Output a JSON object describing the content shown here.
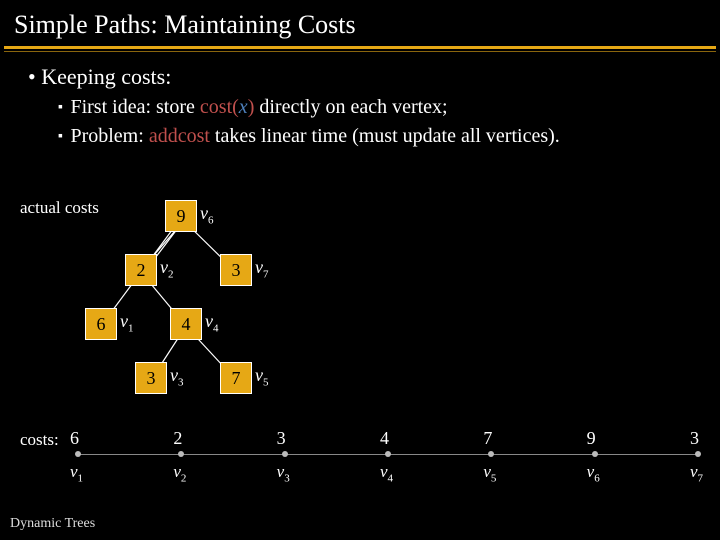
{
  "title": "Simple Paths: Maintaining Costs",
  "bullets": {
    "b1": "Keeping costs:",
    "b2a_pre": "First idea: store ",
    "b2a_fn": "cost",
    "b2a_paren_open": "(",
    "b2a_arg": "x",
    "b2a_paren_close": ")",
    "b2a_post": " directly on each vertex;",
    "b2b_pre": "Problem: ",
    "b2b_fn": "addcost",
    "b2b_post": " takes linear time (must update all vertices)."
  },
  "tree_label": "actual costs",
  "nodes": {
    "v6": {
      "cost": "9",
      "label": "v",
      "sub": "6"
    },
    "v2": {
      "cost": "2",
      "label": "v",
      "sub": "2"
    },
    "v7": {
      "cost": "3",
      "label": "v",
      "sub": "7"
    },
    "v1": {
      "cost": "6",
      "label": "v",
      "sub": "1"
    },
    "v4": {
      "cost": "4",
      "label": "v",
      "sub": "4"
    },
    "v3": {
      "cost": "3",
      "label": "v",
      "sub": "3"
    },
    "v5": {
      "cost": "7",
      "label": "v",
      "sub": "5"
    }
  },
  "costs_label": "costs:",
  "path": {
    "items": [
      {
        "cost": "6",
        "v": "v",
        "sub": "1"
      },
      {
        "cost": "2",
        "v": "v",
        "sub": "2"
      },
      {
        "cost": "3",
        "v": "v",
        "sub": "3"
      },
      {
        "cost": "4",
        "v": "v",
        "sub": "4"
      },
      {
        "cost": "7",
        "v": "v",
        "sub": "5"
      },
      {
        "cost": "9",
        "v": "v",
        "sub": "6"
      },
      {
        "cost": "3",
        "v": "v",
        "sub": "7"
      }
    ]
  },
  "footer": "Dynamic Trees"
}
